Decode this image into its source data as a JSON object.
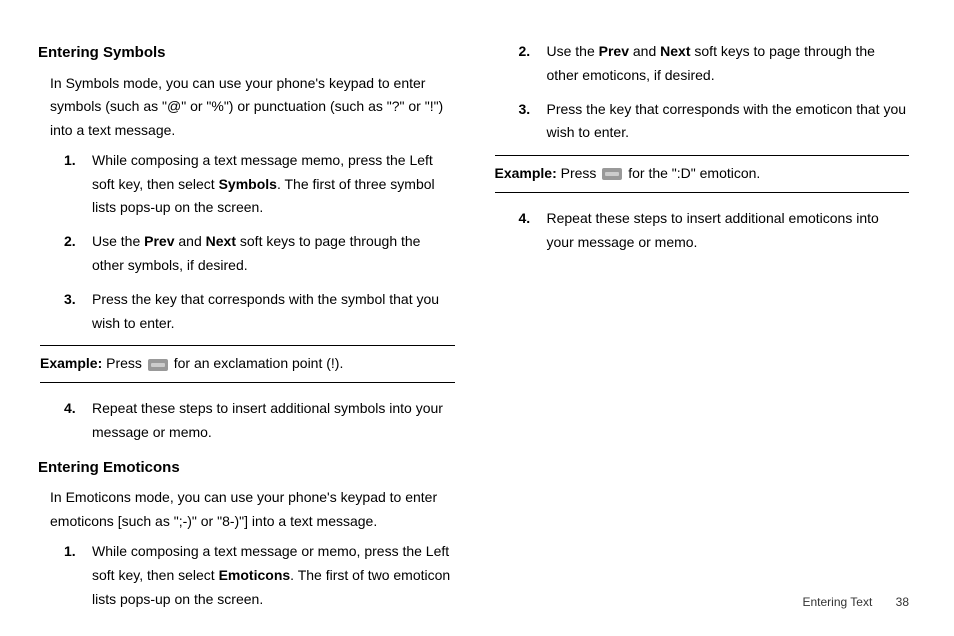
{
  "leftCol": {
    "section1": {
      "heading": "Entering Symbols",
      "intro": "In Symbols mode, you can use your phone's keypad to enter symbols (such as \"@\" or \"%\") or punctuation (such as \"?\" or \"!\") into a text message.",
      "steps": [
        {
          "num": "1.",
          "pre": "While composing a text message memo, press the Left soft key, then select ",
          "bold": "Symbols",
          "post": ". The first of three symbol lists pops-up on the screen."
        },
        {
          "num": "2.",
          "pre": "Use the ",
          "bold": "Prev",
          "mid": " and ",
          "bold2": "Next",
          "post": " soft keys to page through the other symbols, if desired."
        },
        {
          "num": "3.",
          "text": "Press the key that corresponds with the symbol that you wish to enter."
        }
      ],
      "example": {
        "label": "Example:",
        "pre": " Press ",
        "post": " for an exclamation point (!)."
      },
      "step4": {
        "num": "4.",
        "text": "Repeat these steps to insert additional symbols into your message or memo."
      }
    },
    "section2": {
      "heading": "Entering Emoticons",
      "intro": "In Emoticons mode, you can use your phone's keypad to enter emoticons [such as \";-)\" or \"8-)\"] into a text message.",
      "step1": {
        "num": "1.",
        "pre": "While composing a text message or memo, press the Left soft key, then select ",
        "bold": "Emoticons",
        "post": ". The first of two emoticon lists pops-up on the screen."
      }
    }
  },
  "rightCol": {
    "step2": {
      "num": "2.",
      "pre": "Use the ",
      "bold": "Prev",
      "mid": " and ",
      "bold2": "Next",
      "post": " soft keys to page through the other emoticons, if desired."
    },
    "step3": {
      "num": "3.",
      "text": "Press the key that corresponds with the emoticon that you wish to enter."
    },
    "example": {
      "label": "Example:",
      "pre": " Press ",
      "post": " for the \":D\" emoticon."
    },
    "step4": {
      "num": "4.",
      "text": "Repeat these steps to insert additional emoticons into your message or memo."
    }
  },
  "footer": {
    "section": "Entering Text",
    "page": "38"
  }
}
